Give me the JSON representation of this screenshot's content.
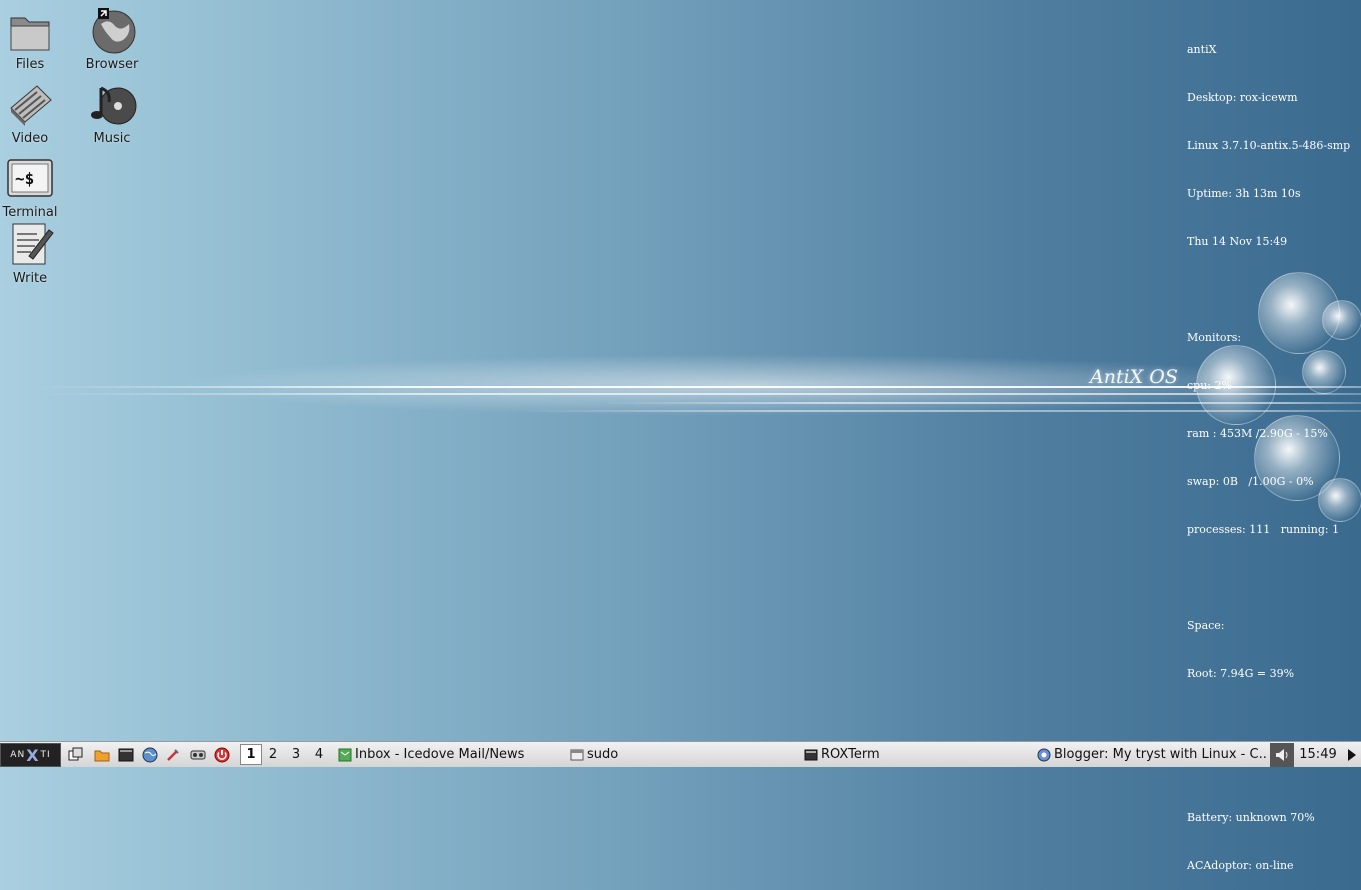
{
  "desktop": {
    "icons": [
      {
        "label": "Files",
        "icon": "folder-icon"
      },
      {
        "label": "Browser",
        "icon": "globe-icon"
      },
      {
        "label": "Video",
        "icon": "video-icon"
      },
      {
        "label": "Music",
        "icon": "music-icon"
      },
      {
        "label": "Terminal",
        "icon": "terminal-icon"
      },
      {
        "label": "Write",
        "icon": "write-icon"
      }
    ],
    "brand": "AntiX OS"
  },
  "conky": {
    "lines": [
      "antiX",
      "Desktop: rox-icewm",
      "Linux 3.7.10-antix.5-486-smp",
      "Uptime: 3h 13m 10s",
      "Thu 14 Nov 15:49",
      "",
      "Monitors:",
      "cpu: 2%",
      "ram : 453M /2.90G - 15%",
      "swap: 0B   /1.00G - 0%",
      "processes: 111   running: 1",
      "",
      "Space:",
      "Root: 7.94G = 39%",
      "",
      "",
      "Battery: unknown 70%",
      "ACAdoptor: on-line"
    ]
  },
  "taskbar": {
    "start_label_left": "AN",
    "start_label_x": "X",
    "start_label_right": "TI",
    "workspaces": [
      "1",
      "2",
      "3",
      "4"
    ],
    "active_workspace": "1",
    "tasks": [
      {
        "label": "Inbox - Icedove Mail/News",
        "icon": "mail-icon"
      },
      {
        "label": "sudo",
        "icon": "window-icon"
      },
      {
        "label": "ROXTerm",
        "icon": "terminal-icon"
      },
      {
        "label": "Blogger: My tryst with Linux - C...",
        "icon": "browser-icon"
      }
    ],
    "clock": "15:49"
  },
  "colors": {
    "wallpaper_light": "#a9cfe0",
    "wallpaper_dark": "#3a6a8e",
    "taskbar_bg": "#e4e4e4"
  }
}
